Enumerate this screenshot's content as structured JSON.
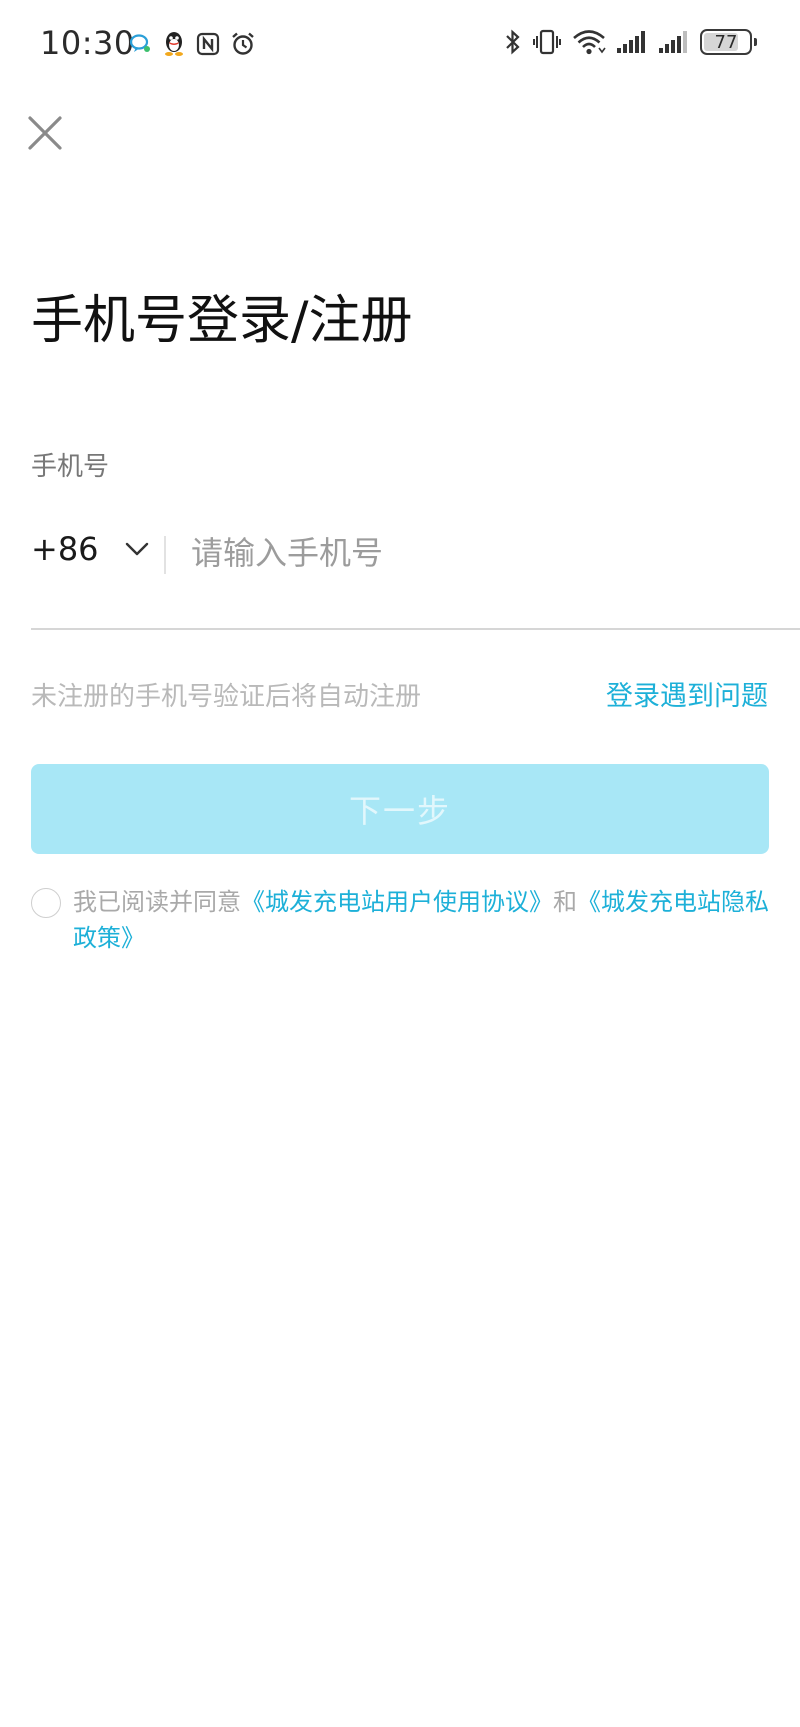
{
  "status_bar": {
    "time": "10:30",
    "battery": "77",
    "battery_level": 0.77,
    "left_icons": [
      "chat-bubble-icon",
      "qq-penguin-icon",
      "nfc-icon",
      "alarm-icon"
    ],
    "right_icons": [
      "bluetooth-icon",
      "vibrate-icon",
      "wifi-icon",
      "signal-icon",
      "signal-icon"
    ]
  },
  "header": {
    "close_icon": "close-icon"
  },
  "main": {
    "title": "手机号登录/注册",
    "phone_label": "手机号",
    "country_code": "+86",
    "phone_placeholder": "请输入手机号",
    "phone_value": "",
    "hint": "未注册的手机号验证后将自动注册",
    "trouble_link": "登录遇到问题",
    "next_button": "下一步"
  },
  "agreement": {
    "prefix": "我已阅读并同意",
    "user_agreement": "《城发充电站用户使用协议》",
    "conjunction": "和",
    "privacy_policy": "《城发充电站隐私政策》",
    "checked": false
  },
  "colors": {
    "accent": "#1db0d8",
    "button_disabled_bg": "#a8e7f6",
    "button_disabled_text": "#e2f7fc",
    "hint": "#b9b9b9",
    "label": "#777777"
  }
}
